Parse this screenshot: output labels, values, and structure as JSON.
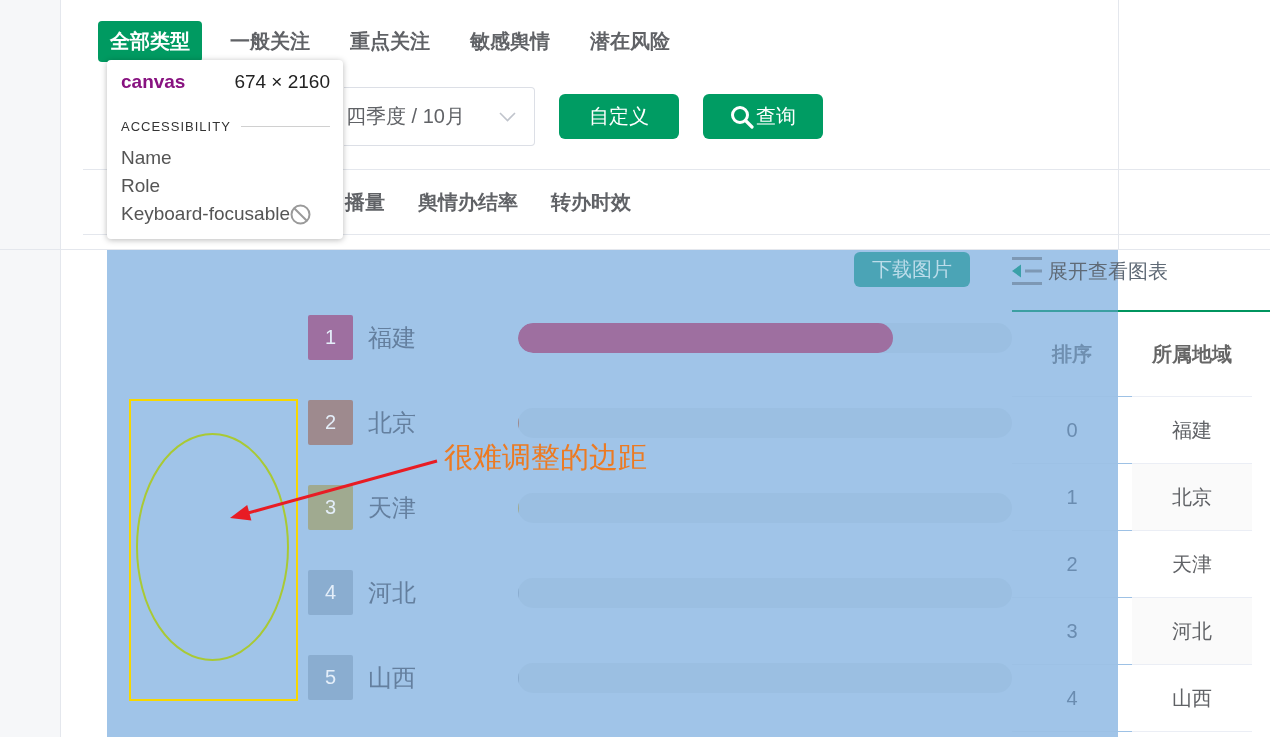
{
  "type_tabs": [
    {
      "label": "全部类型",
      "selected": true
    },
    {
      "label": "一般关注",
      "selected": false
    },
    {
      "label": "重点关注",
      "selected": false
    },
    {
      "label": "敏感舆情",
      "selected": false
    },
    {
      "label": "潜在风险",
      "selected": false
    }
  ],
  "filter_bar": {
    "period_select": {
      "value": "四季度 / 10月"
    },
    "buttons": [
      {
        "label": "自定义",
        "kind": "plain"
      },
      {
        "label": "查询",
        "kind": "search"
      }
    ]
  },
  "metric_tabs": [
    {
      "label": "播量"
    },
    {
      "label": "舆情办结率"
    },
    {
      "label": "转办时效"
    }
  ],
  "ranking_chart": {
    "download_button": "下载图片",
    "items": [
      {
        "rank": "1",
        "name": "福建",
        "color": "#9e6fa0",
        "level": 0.76
      },
      {
        "rank": "2",
        "name": "北京",
        "color": "#9e8a8e",
        "level": 0
      },
      {
        "rank": "3",
        "name": "天津",
        "color": "#a0aa90",
        "level": 0
      },
      {
        "rank": "4",
        "name": "河北",
        "color": "#8aadd0",
        "level": 0
      },
      {
        "rank": "5",
        "name": "山西",
        "color": "#8aadd0",
        "level": 0
      }
    ],
    "annotation": {
      "text": "很难调整的边距"
    }
  },
  "side_panel": {
    "toggle": "展开查看图表",
    "table": {
      "columns": [
        "排序",
        "所属地域"
      ],
      "rows": [
        [
          "0",
          "福建"
        ],
        [
          "1",
          "北京"
        ],
        [
          "2",
          "天津"
        ],
        [
          "3",
          "河北"
        ],
        [
          "4",
          "山西"
        ]
      ]
    }
  },
  "inspect_tooltip": {
    "element": "canvas",
    "size": "674 × 2160",
    "section": "ACCESSIBILITY",
    "properties": [
      {
        "label": "Name",
        "kind": "text"
      },
      {
        "label": "Role",
        "kind": "text"
      },
      {
        "label": "Keyboard-focusable",
        "kind": "flag",
        "on": false
      }
    ]
  }
}
